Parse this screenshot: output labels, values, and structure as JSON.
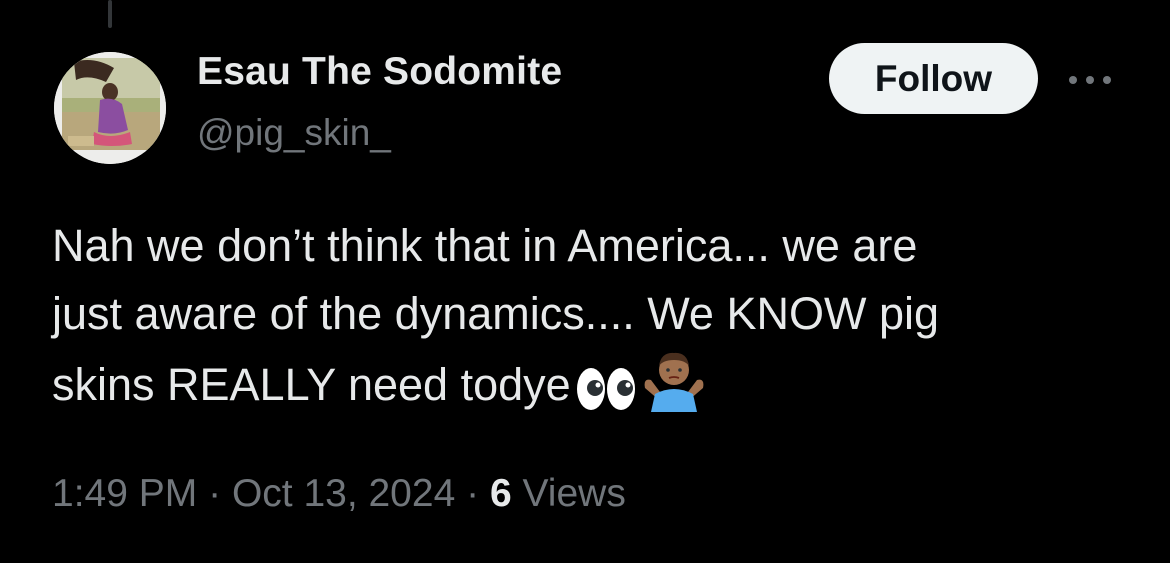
{
  "tweet": {
    "author": {
      "display_name": "Esau The Sodomite",
      "handle": "@pig_skin_"
    },
    "follow_label": "Follow",
    "text_lines": [
      "Nah we don’t think that in America... we are",
      "just aware of the dynamics.... We KNOW pig",
      "skins REALLY need todye"
    ],
    "emojis": [
      "eyes-emoji",
      "person-shrugging-emoji"
    ],
    "time": "1:49 PM",
    "separator": "·",
    "date": "Oct 13, 2024",
    "views_count": "6",
    "views_label": "Views"
  },
  "colors": {
    "background": "#000000",
    "primary_text": "#e7e9ea",
    "secondary_text": "#71767b",
    "follow_bg": "#eff3f4",
    "follow_text": "#0f1419"
  }
}
